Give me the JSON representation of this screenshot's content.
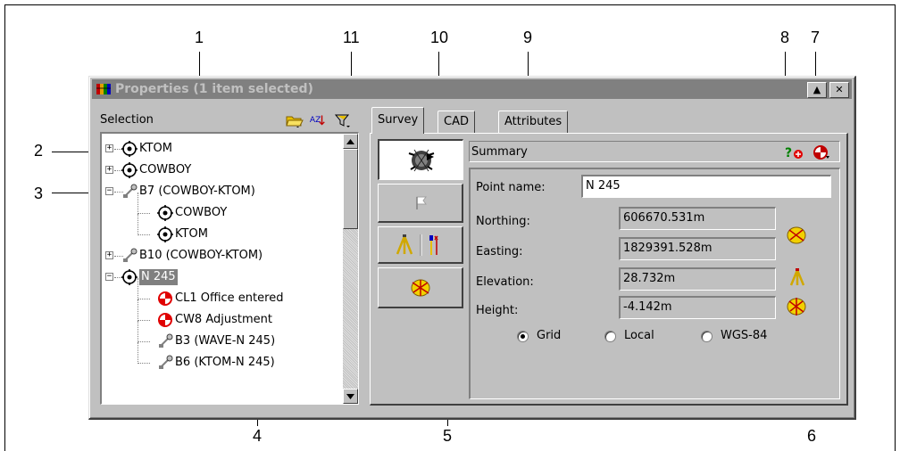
{
  "callouts": {
    "c1": "1",
    "c2": "2",
    "c3": "3",
    "c4": "4",
    "c5": "5",
    "c6": "6",
    "c7": "7",
    "c8": "8",
    "c9": "9",
    "c10": "10",
    "c11": "11"
  },
  "window": {
    "title": "Properties (1 item selected)",
    "minimize_glyph": "▲",
    "close_glyph": "✕"
  },
  "selection": {
    "header_label": "Selection",
    "icons": [
      "folder-open-icon",
      "sort-az-icon",
      "filter-icon"
    ],
    "sort_glyph": "AZ"
  },
  "tree": {
    "items": [
      {
        "label": "KTOM",
        "expander": "+",
        "icon": "point-icon"
      },
      {
        "label": "COWBOY",
        "expander": "+",
        "icon": "point-icon"
      },
      {
        "label": "B7 (COWBOY-KTOM)",
        "expander": "−",
        "icon": "baseline-icon"
      },
      {
        "label": "COWBOY",
        "icon": "point-icon"
      },
      {
        "label": "KTOM",
        "icon": "point-icon"
      },
      {
        "label": "B10 (COWBOY-KTOM)",
        "expander": "+",
        "icon": "baseline-icon"
      },
      {
        "label": "N 245",
        "expander": "−",
        "icon": "point-icon",
        "selected": true
      },
      {
        "label": "CL1 Office entered",
        "icon": "control-point-icon"
      },
      {
        "label": "CW8 Adjustment",
        "icon": "control-point-icon"
      },
      {
        "label": "B3 (WAVE-N 245)",
        "icon": "baseline-icon"
      },
      {
        "label": "B6 (KTOM-N 245)",
        "icon": "baseline-icon"
      }
    ]
  },
  "tabs": [
    {
      "label": "Survey",
      "active": true
    },
    {
      "label": "CAD",
      "active": false
    },
    {
      "label": "Attributes",
      "active": false
    }
  ],
  "side_buttons": [
    "satellite-icon",
    "flag-icon",
    "tripod-and-rod-icon",
    "ellipsoid-icon"
  ],
  "summary": {
    "label": "Summary",
    "help_glyph": "?",
    "icons": [
      "help-add-icon",
      "target-icon"
    ]
  },
  "fields": {
    "point_name_label": "Point name:",
    "point_name_value": "N 245",
    "northing_label": "Northing:",
    "northing_value": "606670.531m",
    "easting_label": "Easting:",
    "easting_value": "1829391.528m",
    "elevation_label": "Elevation:",
    "elevation_value": "28.732m",
    "height_label": "Height:",
    "height_value": "-4.142m"
  },
  "coordinate_system": {
    "options": [
      "Grid",
      "Local",
      "WGS-84"
    ],
    "selected": "Grid"
  },
  "colors": {
    "titlebar_inactive": "#808080",
    "face": "#c0c0c0",
    "selection_bg": "#808080",
    "control_red": "#e00000",
    "ellipsoid_yellow": "#f2d000",
    "tripod_yellow": "#e8c000"
  }
}
